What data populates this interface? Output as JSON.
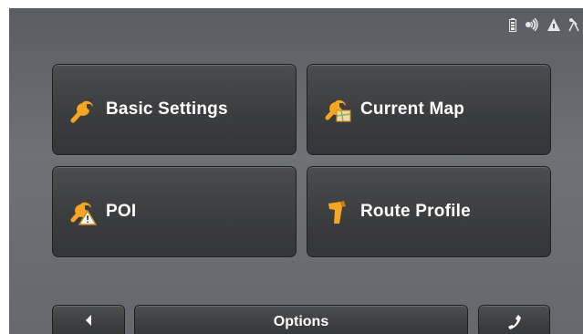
{
  "menu": {
    "tiles": [
      {
        "label": "Basic Settings",
        "icon": "wrench-icon"
      },
      {
        "label": "Current Map",
        "icon": "wrench-map-icon"
      },
      {
        "label": "POI",
        "icon": "wrench-warning-icon"
      },
      {
        "label": "Route Profile",
        "icon": "route-profile-icon"
      }
    ]
  },
  "bottom_bar": {
    "back_icon": "back-arrow-icon",
    "options_label": "Options",
    "phone_icon": "phone-icon"
  },
  "status_icons": [
    "battery-icon",
    "signal-icon",
    "tmc-icon",
    "gps-icon"
  ],
  "colors": {
    "accent": "#f5a623",
    "background": "#65686c",
    "tile": "#3c3d3f",
    "text": "#ffffff"
  }
}
